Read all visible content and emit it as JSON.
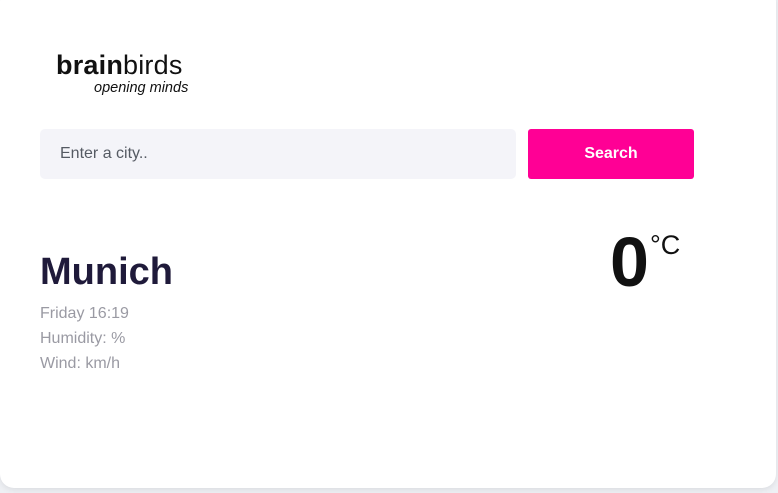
{
  "logo": {
    "brand_bold": "brain",
    "brand_light": "birds",
    "tagline": "opening minds"
  },
  "search": {
    "placeholder": "Enter a city..",
    "button_label": "Search"
  },
  "weather": {
    "city": "Munich",
    "date_time": "Friday 16:19",
    "humidity": "Humidity: %",
    "wind": "Wind: km/h",
    "temperature": "0",
    "unit": "°C"
  },
  "colors": {
    "accent": "#ff0095",
    "city_text": "#1f1a3a",
    "muted_text": "#9a9aa3",
    "input_background": "#f4f4f9"
  }
}
